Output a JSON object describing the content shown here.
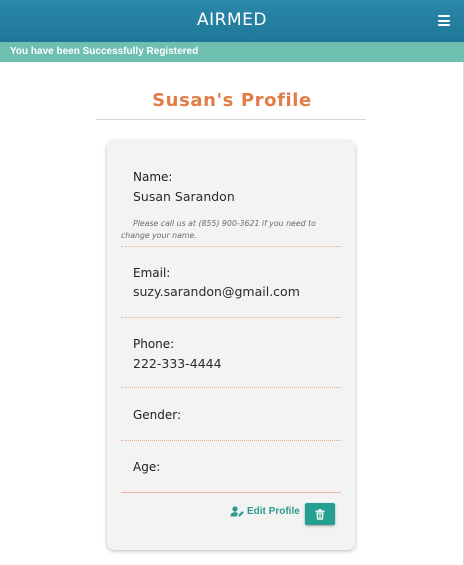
{
  "app": {
    "title": "AIRMED",
    "menu_icon": "hamburger-menu-icon"
  },
  "alert": {
    "message": "You have been Successfully Registered"
  },
  "profile": {
    "title": "Susan's Profile",
    "fields": {
      "name": {
        "label": "Name:",
        "value": "Susan Sarandon",
        "note": "Please call us at (855) 900-3621 if you need to change your name."
      },
      "email": {
        "label": "Email:",
        "value": "suzy.sarandon@gmail.com"
      },
      "phone": {
        "label": "Phone:",
        "value": "222-333-4444"
      },
      "gender": {
        "label": "Gender:",
        "value": ""
      },
      "age": {
        "label": "Age:",
        "value": ""
      }
    },
    "actions": {
      "edit_label": "Edit Profile",
      "edit_icon": "user-edit-icon",
      "delete_icon": "trash-icon"
    }
  },
  "colors": {
    "navbar": "#217ea2",
    "alert": "#6fbfb0",
    "title": "#e27d48",
    "accent": "#23a091",
    "card": "#f3f3f3"
  }
}
